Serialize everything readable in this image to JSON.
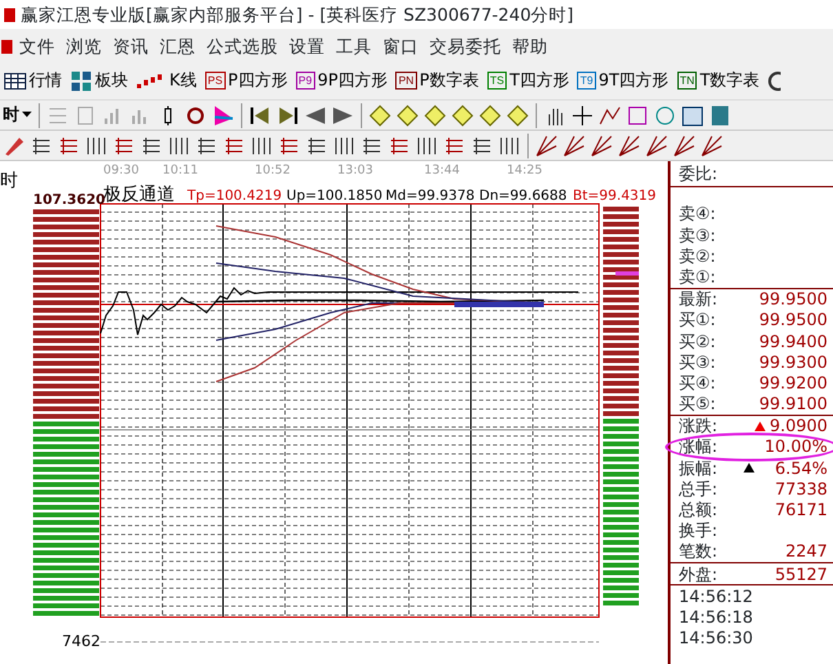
{
  "window": {
    "title": "赢家江恩专业版[赢家内部服务平台] - [英科医疗  SZ300677-240分时]"
  },
  "menu": [
    "文件",
    "浏览",
    "资讯",
    "汇恩",
    "公式选股",
    "设置",
    "工具",
    "窗口",
    "交易委托",
    "帮助"
  ],
  "toolbar": [
    {
      "kind": "table",
      "label": "行情"
    },
    {
      "kind": "blocks",
      "label": "板块"
    },
    {
      "kind": "candles",
      "label": "K线"
    },
    {
      "kind": "badge",
      "badge": "PS",
      "label": "P四方形",
      "color": "#b00000"
    },
    {
      "kind": "badge",
      "badge": "P9",
      "label": "9P四方形",
      "color": "#a000a0"
    },
    {
      "kind": "badge",
      "badge": "PN",
      "label": "P数字表",
      "color": "#800000"
    },
    {
      "kind": "badge",
      "badge": "TS",
      "label": "T四方形",
      "color": "#008000"
    },
    {
      "kind": "badge",
      "badge": "T9",
      "label": "9T四方形",
      "color": "#0070c0"
    },
    {
      "kind": "badge",
      "badge": "TN",
      "label": "T数字表",
      "color": "#006000"
    }
  ],
  "period": "时",
  "chart": {
    "period_label": "时",
    "time_ticks": [
      "09:30",
      "10:11",
      "10:52",
      "13:03",
      "13:44",
      "14:25"
    ],
    "indicator_name": "极反通道",
    "indicator_values": [
      "Tp=100.4219",
      "Up=100.1850",
      "Md=99.9378",
      "Dn=99.6688",
      "Bt=99.4319"
    ],
    "top_price": "107.3620",
    "volume_label": "7462"
  },
  "quote": {
    "ratio_label": "委比:",
    "asks": [
      {
        "label": "卖④:"
      },
      {
        "label": "卖③:"
      },
      {
        "label": "卖②:"
      },
      {
        "label": "卖①:"
      }
    ],
    "last": {
      "label": "最新:",
      "value": "99.9500"
    },
    "bids": [
      {
        "label": "买①:",
        "value": "99.9500"
      },
      {
        "label": "买②:",
        "value": "99.9400"
      },
      {
        "label": "买③:",
        "value": "99.9300"
      },
      {
        "label": "买④:",
        "value": "99.9200"
      },
      {
        "label": "买⑤:",
        "value": "99.9100"
      }
    ],
    "stats": [
      {
        "label": "涨跌:",
        "value": "9.0900",
        "triangle": true,
        "color": "#ee0000",
        "circled": false
      },
      {
        "label": "涨幅:",
        "value": "10.00%",
        "triangle": false,
        "circled": true
      },
      {
        "label": "振幅:",
        "value": "6.54%",
        "triangle": true,
        "color": "#000000",
        "circled": false
      },
      {
        "label": "总手:",
        "value": "77338",
        "triangle": false,
        "circled": false
      },
      {
        "label": "总额:",
        "value": "76171",
        "triangle": false,
        "circled": false
      },
      {
        "label": "换手:",
        "triangle": false,
        "circled": false
      },
      {
        "label": "笔数:",
        "value": "2247",
        "triangle": false,
        "circled": false
      }
    ],
    "outer": {
      "label": "外盘:",
      "value": "55127"
    },
    "ticks": [
      "14:56:12",
      "14:56:18",
      "14:56:30"
    ]
  }
}
